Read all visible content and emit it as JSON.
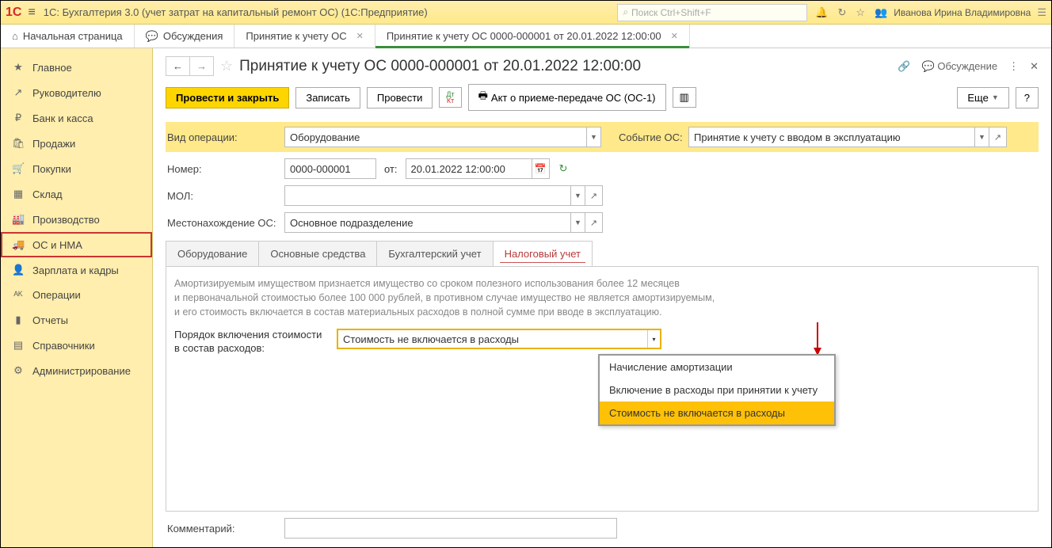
{
  "topbar": {
    "logo": "1C",
    "title": "1С: Бухгалтерия 3.0 (учет затрат на капитальный ремонт ОС)  (1С:Предприятие)",
    "search_placeholder": "Поиск Ctrl+Shift+F",
    "user": "Иванова Ирина Владимировна"
  },
  "tabs": {
    "home": "Начальная страница",
    "discuss": "Обсуждения",
    "t1": "Принятие к учету ОС",
    "t2": "Принятие к учету ОС 0000-000001 от 20.01.2022 12:00:00"
  },
  "sidebar": [
    {
      "icon": "★",
      "label": "Главное"
    },
    {
      "icon": "↗",
      "label": "Руководителю"
    },
    {
      "icon": "₽",
      "label": "Банк и касса"
    },
    {
      "icon": "🛍",
      "label": "Продажи"
    },
    {
      "icon": "🛒",
      "label": "Покупки"
    },
    {
      "icon": "▦",
      "label": "Склад"
    },
    {
      "icon": "🏭",
      "label": "Производство"
    },
    {
      "icon": "🚚",
      "label": "ОС и НМА"
    },
    {
      "icon": "👤",
      "label": "Зарплата и кадры"
    },
    {
      "icon": "ᴬᴷ",
      "label": "Операции"
    },
    {
      "icon": "▮",
      "label": "Отчеты"
    },
    {
      "icon": "▤",
      "label": "Справочники"
    },
    {
      "icon": "⚙",
      "label": "Администрирование"
    }
  ],
  "doc": {
    "title": "Принятие к учету ОС 0000-000001 от 20.01.2022 12:00:00",
    "discuss": "Обсуждение"
  },
  "toolbar": {
    "post_close": "Провести и закрыть",
    "save": "Записать",
    "post": "Провести",
    "print_act": "Акт о приеме-передаче ОС (ОС-1)",
    "more": "Еще",
    "help": "?"
  },
  "form": {
    "op_label": "Вид операции:",
    "op_value": "Оборудование",
    "event_label": "Событие ОС:",
    "event_value": "Принятие к учету с вводом в эксплуатацию",
    "num_label": "Номер:",
    "num_value": "0000-000001",
    "from_label": "от:",
    "date_value": "20.01.2022 12:00:00",
    "mol_label": "МОЛ:",
    "loc_label": "Местонахождение ОС:",
    "loc_value": "Основное подразделение",
    "comment_label": "Комментарий:"
  },
  "dtabs": [
    "Оборудование",
    "Основные средства",
    "Бухгалтерский учет",
    "Налоговый учет"
  ],
  "pane": {
    "hint1": "Амортизируемым имуществом признается имущество со сроком полезного использования более 12 месяцев",
    "hint2": "и первоначальной стоимостью более 100 000 рублей, в противном случае имущество не является амортизируемым,",
    "hint3": "и его стоимость включается в состав материальных расходов в полной сумме при вводе в эксплуатацию.",
    "order_label1": "Порядок включения стоимости",
    "order_label2": "в состав расходов:",
    "order_value": "Стоимость не включается в расходы"
  },
  "dropdown": [
    "Начисление амортизации",
    "Включение в расходы при принятии к учету",
    "Стоимость не включается в расходы"
  ]
}
